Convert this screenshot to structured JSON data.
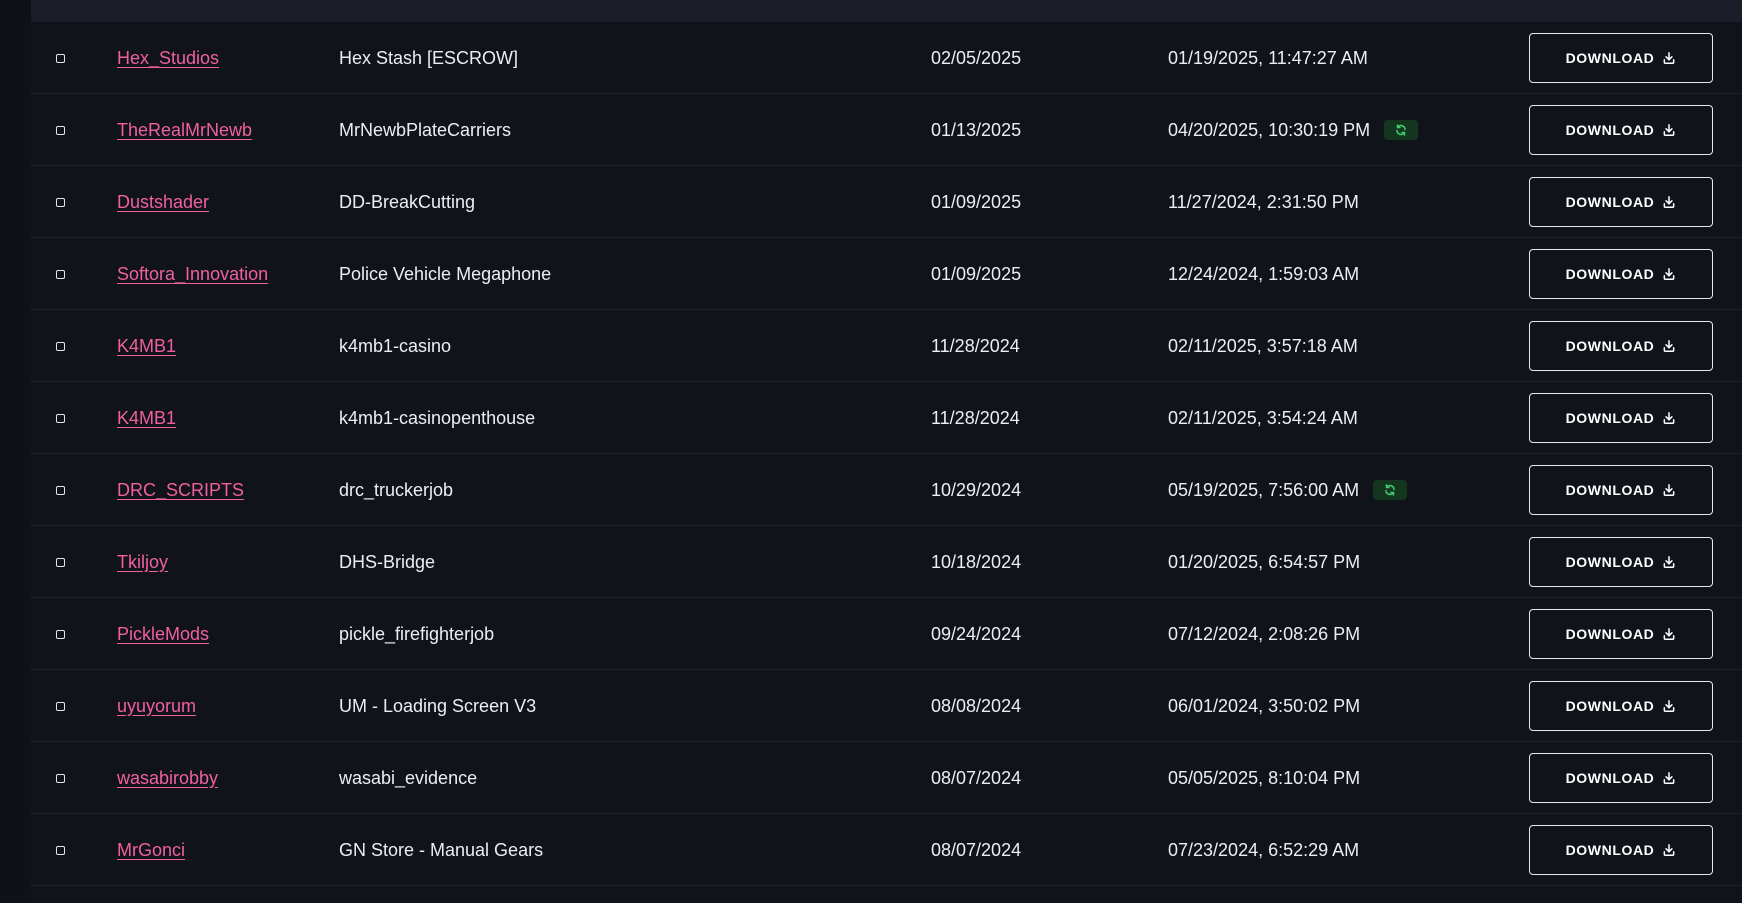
{
  "table": {
    "download_label": "DOWNLOAD",
    "rows": [
      {
        "author": "Hex_Studios",
        "name": "Hex Stash [ESCROW]",
        "date": "02/05/2025",
        "updated": "01/19/2025, 11:47:27 AM",
        "synced": false
      },
      {
        "author": "TheRealMrNewb",
        "name": "MrNewbPlateCarriers",
        "date": "01/13/2025",
        "updated": "04/20/2025, 10:30:19 PM",
        "synced": true
      },
      {
        "author": "Dustshader",
        "name": "DD-BreakCutting",
        "date": "01/09/2025",
        "updated": "11/27/2024, 2:31:50 PM",
        "synced": false
      },
      {
        "author": "Softora_Innovation",
        "name": "Police Vehicle Megaphone",
        "date": "01/09/2025",
        "updated": "12/24/2024, 1:59:03 AM",
        "synced": false
      },
      {
        "author": "K4MB1",
        "name": "k4mb1-casino",
        "date": "11/28/2024",
        "updated": "02/11/2025, 3:57:18 AM",
        "synced": false
      },
      {
        "author": "K4MB1",
        "name": "k4mb1-casinopenthouse",
        "date": "11/28/2024",
        "updated": "02/11/2025, 3:54:24 AM",
        "synced": false
      },
      {
        "author": "DRC_SCRIPTS",
        "name": "drc_truckerjob",
        "date": "10/29/2024",
        "updated": "05/19/2025, 7:56:00 AM",
        "synced": true
      },
      {
        "author": "Tkiljoy",
        "name": "DHS-Bridge",
        "date": "10/18/2024",
        "updated": "01/20/2025, 6:54:57 PM",
        "synced": false
      },
      {
        "author": "PickleMods",
        "name": "pickle_firefighterjob",
        "date": "09/24/2024",
        "updated": "07/12/2024, 2:08:26 PM",
        "synced": false
      },
      {
        "author": "uyuyorum",
        "name": "UM - Loading Screen V3",
        "date": "08/08/2024",
        "updated": "06/01/2024, 3:50:02 PM",
        "synced": false
      },
      {
        "author": "wasabirobby",
        "name": "wasabi_evidence",
        "date": "08/07/2024",
        "updated": "05/05/2025, 8:10:04 PM",
        "synced": false
      },
      {
        "author": "MrGonci",
        "name": "GN Store - Manual Gears",
        "date": "08/07/2024",
        "updated": "07/23/2024, 6:52:29 AM",
        "synced": false
      }
    ]
  },
  "colors": {
    "author_link": "#f0609d",
    "sync_badge_bg": "#14361f",
    "sync_icon": "#3ecf6e"
  },
  "icons": {
    "row_checkbox": "checkbox-icon",
    "sync": "refresh-icon",
    "download": "download-icon"
  }
}
